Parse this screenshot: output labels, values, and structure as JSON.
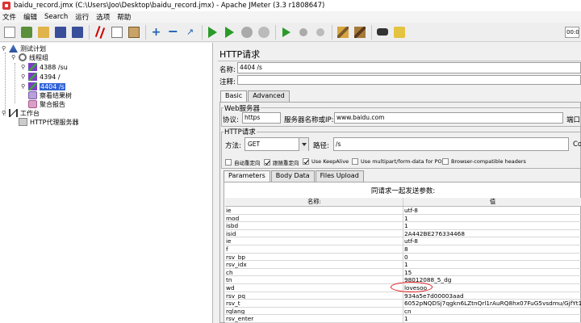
{
  "window": {
    "title": "baidu_record.jmx (C:\\Users\\Joo\\Desktop\\baidu_record.jmx) - Apache JMeter (3.3 r1808647)"
  },
  "menu": [
    "文件",
    "编辑",
    "Search",
    "运行",
    "选项",
    "帮助"
  ],
  "toolbar": {
    "timer_value": "00:0"
  },
  "tree": {
    "test_plan": "测试计划",
    "thread_group": "线程组",
    "samplers": [
      "4388 /su",
      "4394 /",
      "4404 /s"
    ],
    "listener_results_tree": "察看结果树",
    "listener_aggregate": "聚合报告",
    "workbench": "工作台",
    "proxy": "HTTP代理服务器"
  },
  "http_request": {
    "panel_title": "HTTP请求",
    "name_label": "名称:",
    "name_value": "4404 /s",
    "comment_label": "注释:",
    "tabs": [
      "Basic",
      "Advanced"
    ],
    "web_server_title": "Web服务器",
    "protocol_label": "协议:",
    "protocol_value": "https",
    "server_label": "服务器名称或IP:",
    "server_value": "www.baidu.com",
    "port_label": "端口",
    "request_group_title": "HTTP请求",
    "method_label": "方法:",
    "method_value": "GET",
    "path_label": "路径:",
    "path_value": "/s",
    "encoding_label": "Co",
    "checkboxes": [
      {
        "label": "自动重定向",
        "checked": false
      },
      {
        "label": "跟随重定向",
        "checked": true
      },
      {
        "label": "Use KeepAlive",
        "checked": true
      },
      {
        "label": "Use multipart/form-data for POST",
        "checked": false
      },
      {
        "label": "Browser-compatible headers",
        "checked": false
      }
    ],
    "sub_tabs": [
      "Parameters",
      "Body Data",
      "Files Upload"
    ],
    "params_caption": "同请求一起发送参数:",
    "params_header": {
      "name": "名称:",
      "value": "值"
    },
    "params": [
      {
        "name": "ie",
        "value": "utf-8"
      },
      {
        "name": "mod",
        "value": "1"
      },
      {
        "name": "isbd",
        "value": "1"
      },
      {
        "name": "isid",
        "value": "2A442BE276334468"
      },
      {
        "name": "ie",
        "value": "utf-8"
      },
      {
        "name": "f",
        "value": "8"
      },
      {
        "name": "rsv_bp",
        "value": "0"
      },
      {
        "name": "rsv_idx",
        "value": "1"
      },
      {
        "name": "ch",
        "value": "15"
      },
      {
        "name": "tn",
        "value": "98012088_5_dg"
      },
      {
        "name": "wd",
        "value": "lovesoo"
      },
      {
        "name": "rsv_pq",
        "value": "934a5e7d00003aad"
      },
      {
        "name": "rsv_t",
        "value": "6052pNQDSj7qgkn6LZtnQrl1rAuRQ8hx07FuG5vsdmu/GjfYt1svNl..."
      },
      {
        "name": "rqlang",
        "value": "cn"
      },
      {
        "name": "rsv_enter",
        "value": "1"
      }
    ]
  },
  "colors": {
    "selection": "#2f63d6",
    "highlight_ellipse": "#e01010"
  }
}
